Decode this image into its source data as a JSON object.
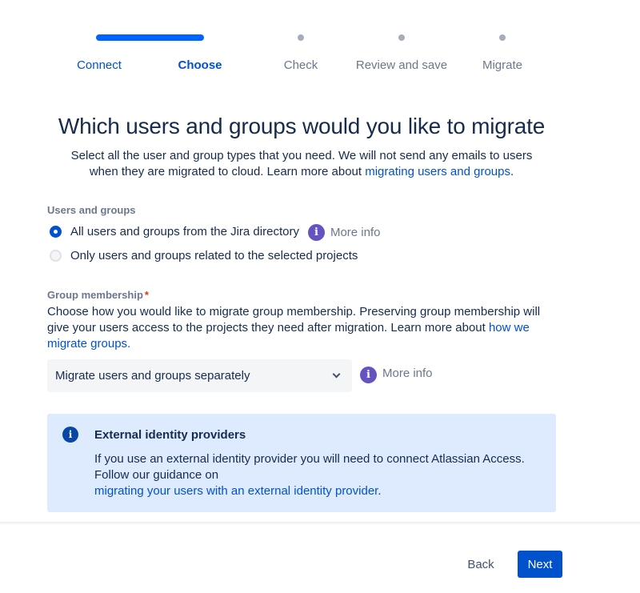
{
  "progress": {
    "steps": [
      {
        "label": "Connect",
        "state": "done"
      },
      {
        "label": "Choose",
        "state": "current"
      },
      {
        "label": "Check",
        "state": "todo"
      },
      {
        "label": "Review and save",
        "state": "todo"
      },
      {
        "label": "Migrate",
        "state": "todo"
      }
    ],
    "completed_fraction": 0.25
  },
  "header": {
    "title": "Which users and groups would you like to migrate",
    "subtitle_pre": "Select all the user and group types that you need. We will not send any emails to users when they are migrated to cloud. Learn more about ",
    "subtitle_link": "migrating users and groups",
    "subtitle_post": "."
  },
  "users_groups": {
    "label": "Users and groups",
    "options": [
      {
        "label": "All users and groups from the Jira directory",
        "selected": true
      },
      {
        "label": "Only users and groups related to the selected projects",
        "selected": false
      }
    ],
    "more_info": "More info",
    "info_icon_glyph": "i"
  },
  "group_membership": {
    "label": "Group membership",
    "required_marker": "*",
    "desc_pre": "Choose how you would like to migrate group membership. Preserving group membership will give your users access to the projects they need after migration. Learn more about ",
    "desc_link": "how we migrate groups.",
    "select_value": "Migrate users and groups separately",
    "more_info": "More info",
    "info_icon_glyph": "i"
  },
  "info_panel": {
    "icon_glyph": "i",
    "title": "External identity providers",
    "body_pre": "If you use an external identity provider you will need to connect Atlassian Access. Follow our guidance on",
    "body_link": "migrating your users with an external identity provider",
    "body_post": "."
  },
  "footer": {
    "back_label": "Back",
    "next_label": "Next"
  },
  "colors": {
    "brand_blue": "#0052cc",
    "progress_blue": "#0065ff",
    "info_purple": "#6554c0",
    "panel_bg": "#deebff",
    "required_red": "#de350b"
  }
}
